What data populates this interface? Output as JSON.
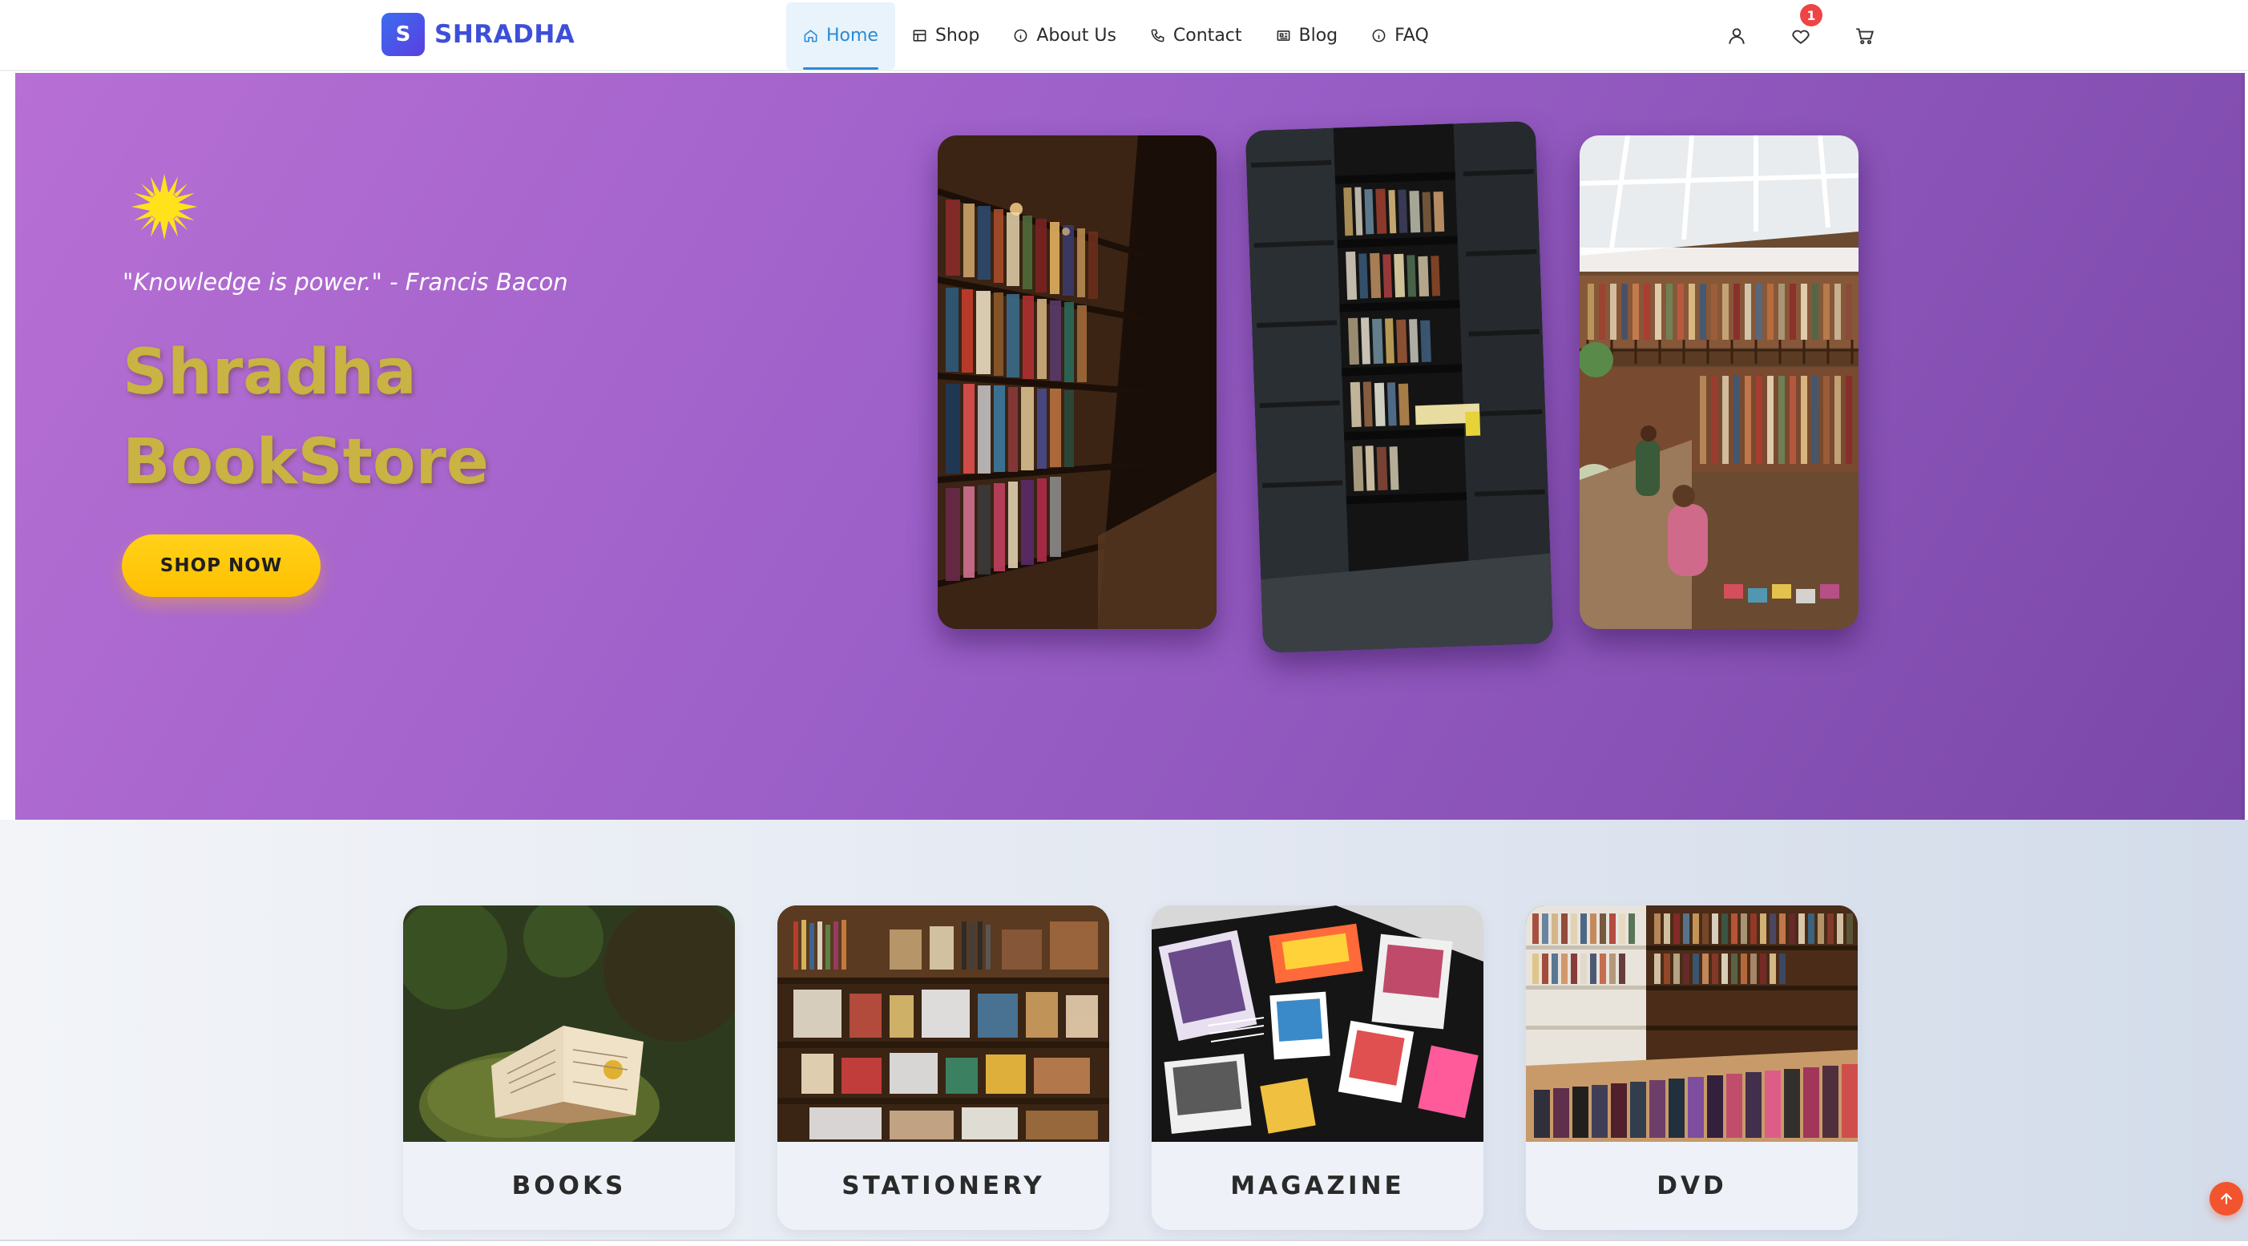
{
  "brand": {
    "logo_letter": "S",
    "name": "SHRADHA",
    "accent": "#3d4fd8"
  },
  "nav": {
    "items": [
      {
        "label": "Home",
        "icon": "home-icon",
        "active": true
      },
      {
        "label": "Shop",
        "icon": "shop-icon",
        "active": false
      },
      {
        "label": "About Us",
        "icon": "info-icon",
        "active": false
      },
      {
        "label": "Contact",
        "icon": "phone-icon",
        "active": false
      },
      {
        "label": "Blog",
        "icon": "newspaper-icon",
        "active": false
      },
      {
        "label": "FAQ",
        "icon": "info-icon",
        "active": false
      }
    ],
    "actions": [
      {
        "icon": "user-icon"
      },
      {
        "icon": "heart-icon",
        "badge": "1"
      },
      {
        "icon": "cart-icon"
      }
    ]
  },
  "hero": {
    "quote": "\"Knowledge is power.\" - Francis Bacon",
    "title_line1": "Shradha",
    "title_line2": "BookStore",
    "cta_label": "SHOP NOW",
    "background_colors": [
      "#b76fd4",
      "#7a48a8"
    ],
    "title_color": "#c9b342",
    "cta_color": "#ffc400",
    "gallery": [
      {
        "icon": "library-shelves-image"
      },
      {
        "icon": "bookstore-tower-image"
      },
      {
        "icon": "bookstore-hall-image"
      }
    ]
  },
  "categories": [
    {
      "label": "BOOKS",
      "icon": "open-book-image"
    },
    {
      "label": "STATIONERY",
      "icon": "stationery-shop-image"
    },
    {
      "label": "MAGAZINE",
      "icon": "magazine-collage-image"
    },
    {
      "label": "DVD",
      "icon": "dvd-store-image"
    }
  ],
  "scroll_top": {
    "icon": "arrow-up-icon",
    "color": "#f2542d"
  }
}
